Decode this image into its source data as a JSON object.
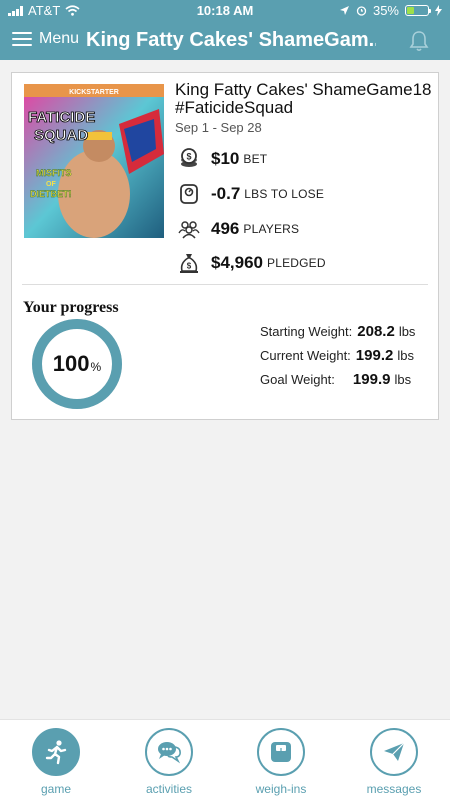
{
  "status_bar": {
    "carrier": "AT&T",
    "time": "10:18 AM",
    "battery": "35%"
  },
  "nav": {
    "menu_label": "Menu",
    "title": "King Fatty Cakes' ShameGam..."
  },
  "game": {
    "cover_banner": "KICKSTARTER",
    "cover_lines": [
      "FATICIDE",
      "SQUAD"
    ],
    "cover_tagline": [
      "MISFITS",
      "OF",
      "DIETBET!"
    ],
    "title": "King Fatty Cakes' ShameGame18 #FaticideSquad",
    "dates": "Sep 1 - Sep 28",
    "stats": [
      {
        "icon": "coin-stack-icon",
        "value": "$10",
        "label": "BET"
      },
      {
        "icon": "scale-icon",
        "value": "-0.7",
        "label": "LBS TO LOSE"
      },
      {
        "icon": "players-icon",
        "value": "496",
        "label": "PLAYERS"
      },
      {
        "icon": "money-bag-icon",
        "value": "$4,960",
        "label": "PLEDGED"
      }
    ]
  },
  "progress": {
    "title": "Your progress",
    "value": "100",
    "unit": "%",
    "fraction": 1.0,
    "weights": [
      {
        "label": "Starting Weight:",
        "value": "208.2",
        "unit": "lbs"
      },
      {
        "label": "Current Weight:",
        "value": "199.2",
        "unit": "lbs"
      },
      {
        "label": "Goal Weight:",
        "value": "199.9",
        "unit": "lbs"
      }
    ]
  },
  "tabs": [
    {
      "label": "game",
      "icon": "runner-icon",
      "active": true
    },
    {
      "label": "activities",
      "icon": "chat-bubbles-icon",
      "active": false
    },
    {
      "label": "weigh-ins",
      "icon": "scale-icon",
      "active": false
    },
    {
      "label": "messages",
      "icon": "paper-plane-icon",
      "active": false
    }
  ],
  "colors": {
    "brand": "#5a9fb0",
    "ring": "#5a9fb0"
  }
}
